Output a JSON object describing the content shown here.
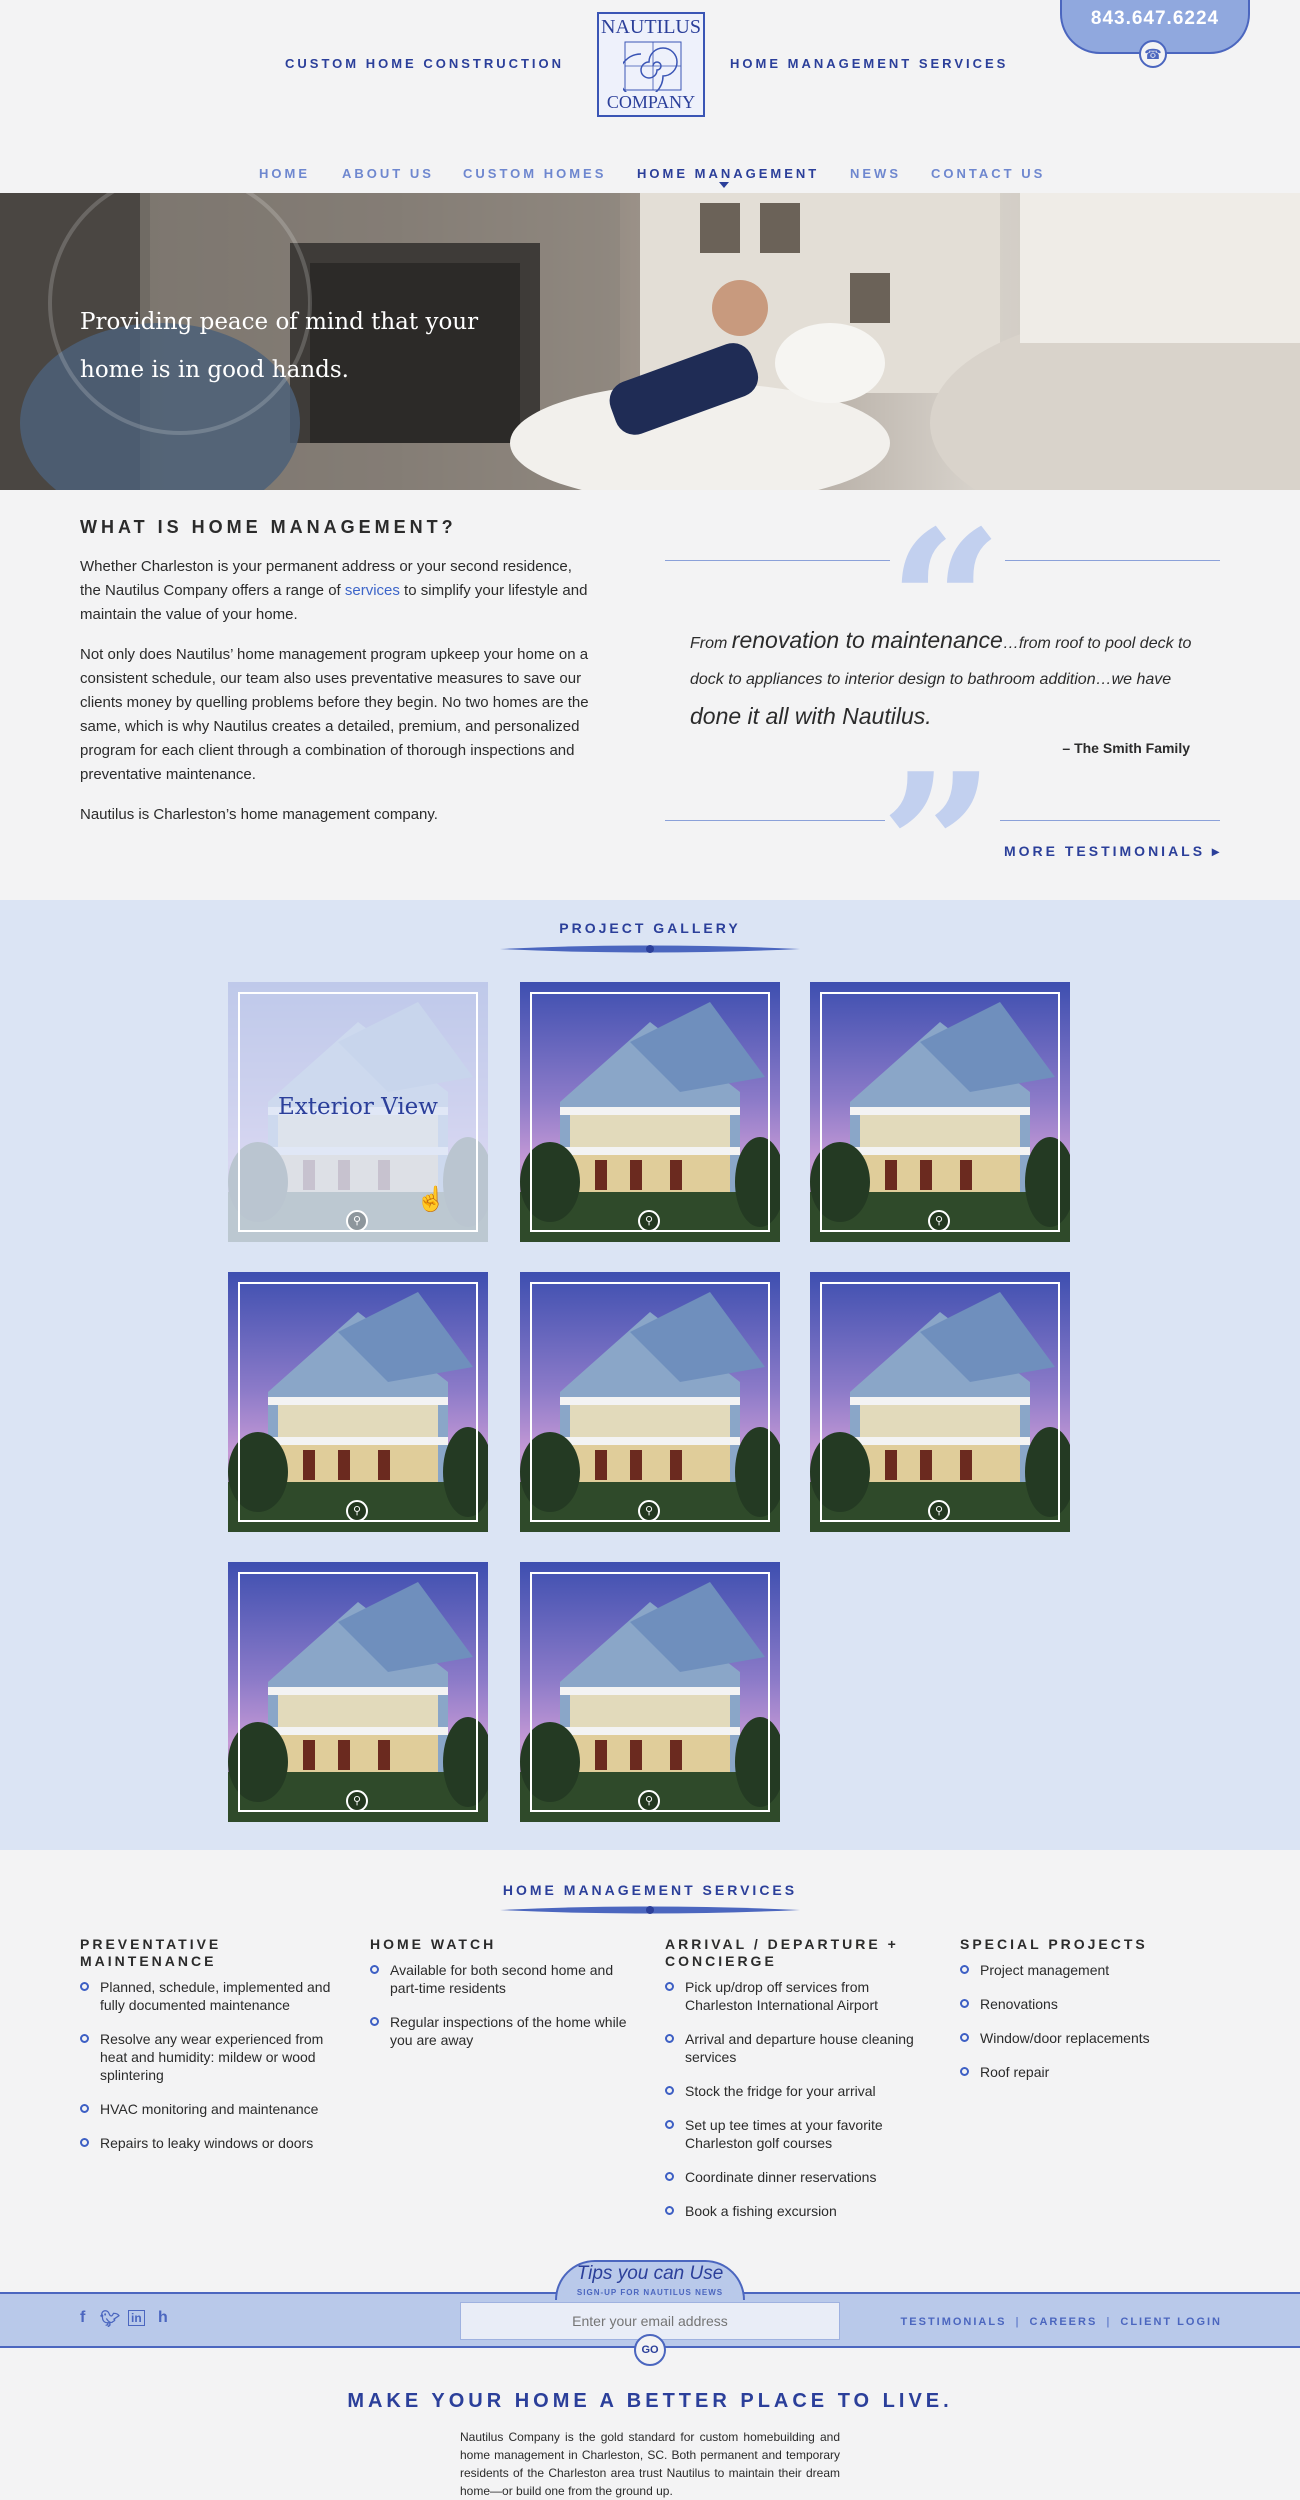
{
  "header": {
    "left_link": "CUSTOM HOME CONSTRUCTION",
    "right_link": "HOME MANAGEMENT SERVICES",
    "logo_top": "NAUTILUS",
    "logo_bottom": "COMPANY",
    "phone": "843.647.6224"
  },
  "nav": {
    "items": [
      "HOME",
      "ABOUT US",
      "CUSTOM HOMES",
      "HOME MANAGEMENT",
      "NEWS",
      "CONTACT US"
    ],
    "active": "HOME MANAGEMENT"
  },
  "hero": {
    "line1": "Providing peace of mind that your",
    "line2": "home is in good hands."
  },
  "intro": {
    "heading": "WHAT IS HOME MANAGEMENT?",
    "p1_a": "Whether Charleston is your permanent address or your second residence, the Nautilus Company offers a range of ",
    "p1_link": "services",
    "p1_b": " to simplify your lifestyle and maintain the value of your home.",
    "p2": "Not only does Nautilus’ home management program upkeep your home on a consistent schedule, our team also uses preventative measures to save our clients money by quelling problems before they begin. No two homes are the same, which is why Nautilus creates a detailed, premium, and personalized program for each client through a combination of thorough inspections and preventative maintenance.",
    "p3": "Nautilus is Charleston’s home management company."
  },
  "testimonial": {
    "t1": "From ",
    "t2": "renovation to maintenance",
    "t3": "…from roof to pool deck to dock to appliances to interior design to bathroom addition…we have ",
    "t4": "done it all with Nautilus.",
    "author": "– The Smith Family",
    "more": "MORE TESTIMONIALS"
  },
  "gallery": {
    "title": "PROJECT GALLERY",
    "hover_label": "Exterior View",
    "tile_count": 8
  },
  "services": {
    "title": "HOME MANAGEMENT SERVICES",
    "columns": [
      {
        "heading": "PREVENTATIVE MAINTENANCE",
        "items": [
          "Planned, schedule, implemented and fully documented maintenance",
          "Resolve any wear experienced from heat and humidity: mildew or wood splintering",
          "HVAC monitoring and maintenance",
          "Repairs to leaky windows or doors"
        ]
      },
      {
        "heading": "HOME WATCH",
        "items": [
          "Available for both second home and part-time residents",
          "Regular inspections of the home while you are away"
        ]
      },
      {
        "heading": "ARRIVAL / DEPARTURE + CONCIERGE",
        "items": [
          "Pick up/drop off services from Charleston International Airport",
          "Arrival and departure house cleaning services",
          "Stock the fridge for your arrival",
          "Set up tee times at your favorite Charleston golf courses",
          "Coordinate dinner reservations",
          "Book a fishing excursion"
        ]
      },
      {
        "heading": "SPECIAL PROJECTS",
        "items": [
          "Project management",
          "Renovations",
          "Window/door replacements",
          "Roof repair"
        ]
      }
    ]
  },
  "footer": {
    "tips_title": "Tips you can Use",
    "tips_sub": "SIGN-UP FOR NAUTILUS NEWS",
    "email_placeholder": "Enter your email address",
    "go": "GO",
    "links": [
      "TESTIMONIALS",
      "CAREERS",
      "CLIENT LOGIN"
    ],
    "social_icons": [
      "facebook-icon",
      "twitter-icon",
      "linkedin-icon",
      "houzz-icon"
    ],
    "tagline": "MAKE YOUR HOME A BETTER PLACE TO LIVE.",
    "about": "Nautilus Company is the gold standard for custom homebuilding and home management in Charleston, SC. Both permanent and temporary residents of the Charleston area trust Nautilus to maintain their dream home—or build one from the ground up."
  },
  "colors": {
    "brand_blue": "#2b3f9a",
    "accent_blue": "#4b66bf",
    "gallery_bg": "#dbe4f4"
  }
}
